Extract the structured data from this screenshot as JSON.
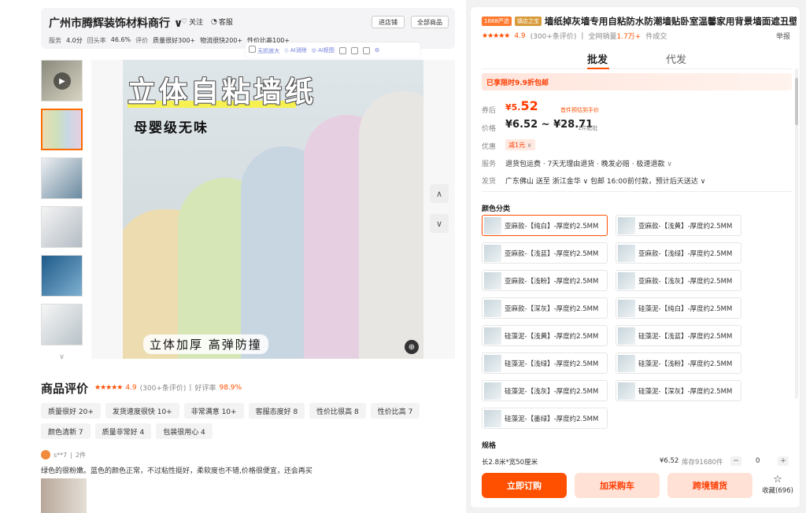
{
  "store": {
    "name": "广州市腾辉装饰材料商行",
    "follow": "关注",
    "service": "客服",
    "enter_shop": "进店铺",
    "all_products": "全部商品",
    "stats": [
      "服务",
      "4.0分",
      "回头率",
      "46.6%",
      "评价",
      "质量很好300+",
      "物流很快200+",
      "性价比高100+"
    ]
  },
  "image_tools": [
    "无损放大",
    "AI消除",
    "AI抠图"
  ],
  "hero": {
    "title": "立体自粘墙纸",
    "subtitle": "母婴级无味",
    "bottom_text": "立体加厚 高弹防撞"
  },
  "reviews": {
    "title": "商品评价",
    "score": "4.9",
    "count": "(300+条评价)",
    "divider": "|",
    "good_rate_label": "好评率",
    "good_rate": "98.9%",
    "tags": [
      "质量很好 20+",
      "发货速度很快 10+",
      "非常满意 10+",
      "客服态度好 8",
      "性价比很高 8",
      "性价比高 7",
      "颜色清新 7",
      "质量非常好 4",
      "包装很用心 4"
    ],
    "first": {
      "user": "s**7",
      "count": "2件",
      "text": "绿色的很粉嫩。蓝色的颜色正常，不过粘性挺好，柔软度也不错,价格很便宜，还会再买"
    }
  },
  "product": {
    "badge1": "1688严选",
    "badge2": "镇店之宝",
    "title": "墙纸掉灰墙专用自粘防水防潮墙贴卧室温馨家用背景墙面遮丑壁纸",
    "score": "4.9",
    "review_count": "(300+条评价)",
    "sales_label": "全网销量",
    "sales": "1.7万+",
    "sales_unit": "件成交",
    "report": "举报",
    "tabs": [
      "批发",
      "代发"
    ],
    "promo": "已享限时9.9折包邮",
    "coupon_label": "券后",
    "coupon_price_int": "¥5.",
    "coupon_price_dec": "52",
    "coupon_note": "首件预估到手价",
    "price_label": "价格",
    "price_range": "¥6.52 ~ ¥28.71",
    "price_min": "1件起批",
    "discount_label": "优惠",
    "discount_chip": "减1元",
    "service_label": "服务",
    "service_text": "退货包运费 · 7天无理由退货 · 晚发必赔 · 极速退款",
    "ship_label": "发货",
    "ship_text": "广东佛山 送至 浙江金华 ∨  包邮  16:00前付款，预计后天送达 ∨",
    "color_label": "颜色分类",
    "variants": [
      "亚麻款-【纯白】-厚度约2.5MM",
      "亚麻款-【浅黄】-厚度约2.5MM",
      "亚麻款-【浅蓝】-厚度约2.5MM",
      "亚麻款-【浅绿】-厚度约2.5MM",
      "亚麻款-【浅粉】-厚度约2.5MM",
      "亚麻款-【浅灰】-厚度约2.5MM",
      "亚麻款-【深灰】-厚度约2.5MM",
      "硅藻泥-【纯白】-厚度约2.5MM",
      "硅藻泥-【浅黄】-厚度约2.5MM",
      "硅藻泥-【浅蓝】-厚度约2.5MM",
      "硅藻泥-【浅绿】-厚度约2.5MM",
      "硅藻泥-【浅粉】-厚度约2.5MM",
      "硅藻泥-【浅灰】-厚度约2.5MM",
      "硅藻泥-【深灰】-厚度约2.5MM",
      "硅藻泥-【墨绿】-厚度约2.5MM"
    ],
    "spec_label": "规格",
    "spec": {
      "name": "长2.8米*宽50厘米",
      "price": "¥6.52",
      "stock": "库存91680件",
      "minus": "−",
      "qty": "0",
      "plus": "+"
    },
    "buy_now": "立即订购",
    "add_cart": "加采购车",
    "cross_border": "跨境铺货",
    "favorite": "收藏(696)"
  },
  "colors": {
    "accent": "#ff5000",
    "price": "#ff3c00"
  }
}
